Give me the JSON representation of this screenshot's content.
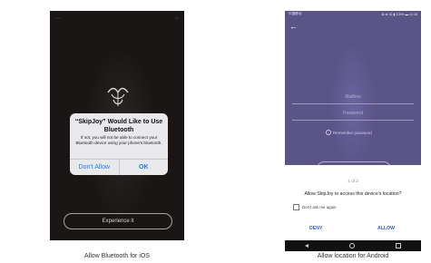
{
  "ios": {
    "alert_title": "“SkipJoy” Would Like to Use Bluetooth",
    "alert_message": "If not, you will not be able to connect your Bluetooth device using your phone's bluetooth.",
    "dont_allow_label": "Don't Allow",
    "ok_label": "OK",
    "experience_label": "Experience it",
    "caption": "Allow Bluetooth for iOS",
    "alert_button_color": "#1b7cf5"
  },
  "android": {
    "status_left": "中国移动",
    "status_right": "⊠ ⊗ 32 ▮ 100% ▬ 11:18",
    "back_icon": "arrow-left-icon",
    "username_placeholder": "Mailbox",
    "password_placeholder": "Password",
    "remember_label": "Remember password",
    "dialog_count": "1 of 2",
    "dialog_question": "Allow SkipJoy to access this device's location?",
    "dont_ask_label": "Don't ask me again",
    "deny_label": "DENY",
    "allow_label": "ALLOW",
    "caption": "Allow location for Android",
    "accent_color": "#5b5487",
    "dialog_button_color": "#3a5cc4"
  }
}
